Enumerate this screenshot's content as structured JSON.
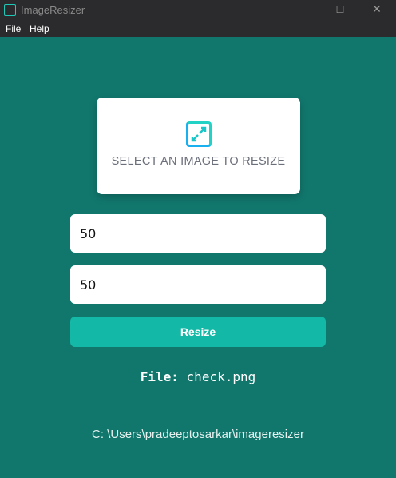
{
  "window": {
    "title": "ImageResizer"
  },
  "menu": [
    "File",
    "Help"
  ],
  "dropzone": {
    "label": "SELECT AN IMAGE TO RESIZE"
  },
  "width_value": "50",
  "height_value": "50",
  "resize_label": "Resize",
  "file": {
    "label": "File:",
    "name": "check.png"
  },
  "output_path": "C: \\Users\\pradeeptosarkar\\imageresizer"
}
